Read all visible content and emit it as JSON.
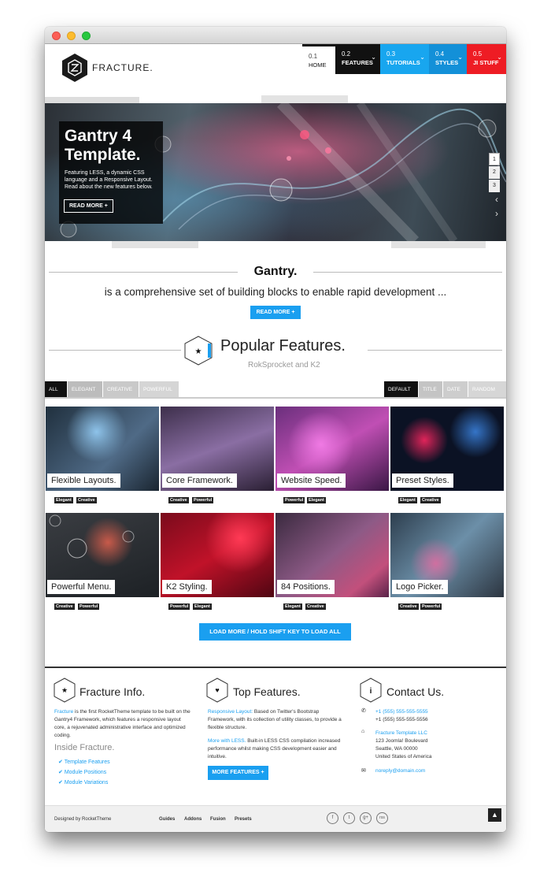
{
  "brand": {
    "name": "FRACTURE."
  },
  "nav": [
    {
      "num": "0.1",
      "label": "HOME"
    },
    {
      "num": "0.2",
      "label": "FEATURES"
    },
    {
      "num": "0.3",
      "label": "TUTORIALS"
    },
    {
      "num": "0.4",
      "label": "STYLES"
    },
    {
      "num": "0.5",
      "label": "JI STUFF"
    }
  ],
  "hero": {
    "title1": "Gantry 4",
    "title2": "Template.",
    "text": "Featuring LESS, a dynamic CSS language and a Responsive Layout. Read about the new features below.",
    "button": "READ MORE",
    "pages": [
      "1",
      "2",
      "3"
    ],
    "arrow_up": "‹",
    "arrow_down": "›"
  },
  "gantry": {
    "title": "Gantry.",
    "subtitle": "is a comprehensive set of building blocks to enable rapid development ...",
    "button": "READ MORE"
  },
  "popular": {
    "title": "Popular Features.",
    "subtitle": "RokSprocket and K2"
  },
  "filter": {
    "left": [
      "ALL",
      "ELEGANT",
      "CREATIVE",
      "POWERFUL"
    ],
    "right": [
      "DEFAULT",
      "TITLE",
      "DATE",
      "RANDOM"
    ]
  },
  "tiles": [
    {
      "label": "Flexible Layouts.",
      "tags": [
        "Elegant",
        "Creative"
      ]
    },
    {
      "label": "Core Framework.",
      "tags": [
        "Creative",
        "Powerful"
      ]
    },
    {
      "label": "Website Speed.",
      "tags": [
        "Powerful",
        "Elegant"
      ]
    },
    {
      "label": "Preset Styles.",
      "tags": [
        "Elegant",
        "Creative"
      ]
    },
    {
      "label": "Powerful Menu.",
      "tags": [
        "Creative",
        "Powerful"
      ]
    },
    {
      "label": "K2 Styling.",
      "tags": [
        "Powerful",
        "Elegant"
      ]
    },
    {
      "label": "84 Positions.",
      "tags": [
        "Elegant",
        "Creative"
      ]
    },
    {
      "label": "Logo Picker.",
      "tags": [
        "Creative",
        "Powerful"
      ]
    }
  ],
  "loadmore": {
    "label": "LOAD MORE / HOLD SHIFT KEY TO LOAD ALL"
  },
  "footer": {
    "info": {
      "title": "Fracture Info.",
      "link": "Fracture",
      "text": "is the first RocketTheme template to be built on the Gantry4 Framework, which features a responsive layout core, a rejuvenated administrative interface and optimized coding.",
      "inside": "Inside Fracture.",
      "items": [
        "Template Features",
        "Module Positions",
        "Module Variations"
      ]
    },
    "features": {
      "title": "Top Features.",
      "p1_link": "Responsive Layout:",
      "p1": "Based on Twitter's Bootstrap Framework, with its collection of utility classes, to provide a flexible structure.",
      "p2_link": "More with LESS.",
      "p2": "Built-in LESS CSS compilation increased performance whilst making CSS development easier and intuitive.",
      "button": "MORE FEATURES"
    },
    "contact": {
      "title": "Contact Us.",
      "phone1": "+1 (555) 555-555-5555",
      "phone2": "+1 (555) 555-555-5556",
      "company": "Fracture Template LLC",
      "addr1": "123 Joomla! Boulevard",
      "addr2": "Seattle, WA 00000",
      "addr3": "United States of America",
      "email": "noreply@domain.com"
    }
  },
  "bottom": {
    "designed": "Designed by RocketTheme",
    "links": [
      "Guides",
      "Addons",
      "Fusion",
      "Presets"
    ],
    "social": [
      "f",
      "t",
      "g+",
      "rss"
    ]
  }
}
